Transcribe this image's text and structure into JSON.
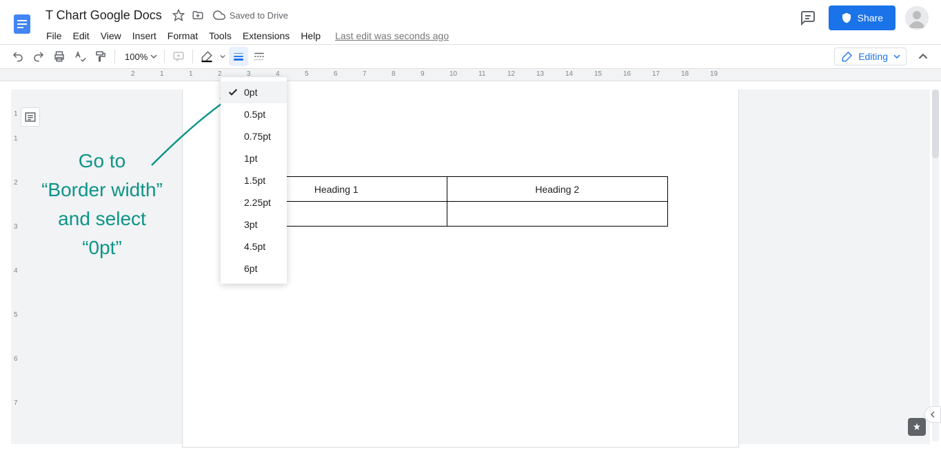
{
  "header": {
    "title": "T Chart Google Docs",
    "save_status": "Saved to Drive",
    "share_label": "Share",
    "last_edit": "Last edit was seconds ago"
  },
  "menus": [
    "File",
    "Edit",
    "View",
    "Insert",
    "Format",
    "Tools",
    "Extensions",
    "Help"
  ],
  "toolbar": {
    "zoom": "100%",
    "editing_label": "Editing"
  },
  "ruler": {
    "h": [
      "2",
      "1",
      "1",
      "2",
      "3",
      "4",
      "5",
      "6",
      "7",
      "8",
      "9",
      "10",
      "11",
      "12",
      "13",
      "14",
      "15",
      "16",
      "17",
      "18",
      "19"
    ],
    "v": [
      "1",
      "1",
      "2",
      "3",
      "4",
      "5",
      "6",
      "7"
    ]
  },
  "dropdown": {
    "selected": "0pt",
    "items": [
      "0pt",
      "0.5pt",
      "0.75pt",
      "1pt",
      "1.5pt",
      "2.25pt",
      "3pt",
      "4.5pt",
      "6pt"
    ]
  },
  "table": {
    "headings": [
      "Heading 1",
      "Heading 2"
    ]
  },
  "annotation": {
    "line1": "Go to",
    "line2": "“Border width”",
    "line3": "and select",
    "line4": "“0pt”"
  }
}
